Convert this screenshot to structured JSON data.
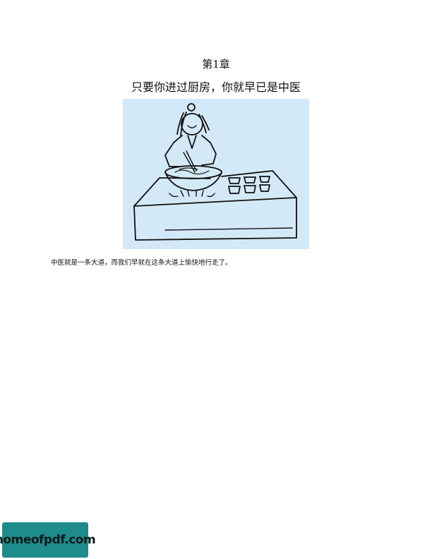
{
  "chapter": {
    "label": "第1章",
    "title": "只要你进过厨房，你就早已是中医"
  },
  "illustration": {
    "icon": "cooking-person-illustration",
    "background_color": "#d4e9f7"
  },
  "caption": "中医就是一条大道，而我们早就在这条大道上愉快地行走了。",
  "watermark": {
    "text": "homeofpdf.com",
    "color": "#1d8c8a"
  }
}
